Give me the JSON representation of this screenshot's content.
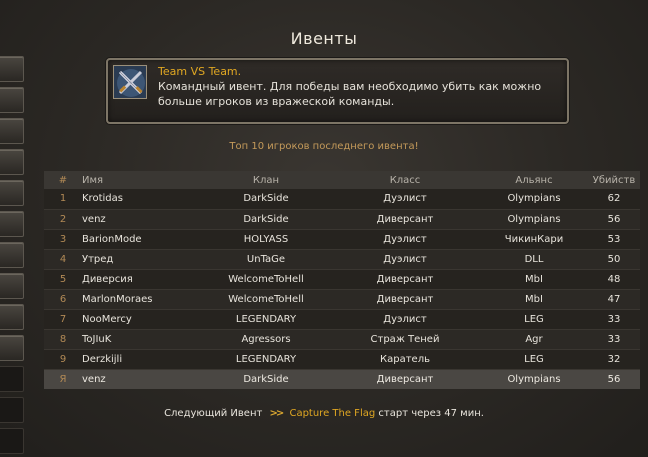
{
  "window": {
    "title": "Ивенты"
  },
  "event": {
    "name": "Team VS Team.",
    "description": "Командный ивент. Для победы вам необходимо убить как можно больше игроков из вражеской команды.",
    "icon": "crossed-swords-icon"
  },
  "subtitle": "Топ 10 игроков последнего ивента!",
  "table": {
    "columns": [
      "#",
      "Имя",
      "Клан",
      "Класс",
      "Альянс",
      "Убийств"
    ],
    "rows": [
      {
        "rank": "1",
        "name": "Krotidas",
        "clan": "DarkSide",
        "class": "Дуэлист",
        "ally": "Olympians",
        "kills": "62"
      },
      {
        "rank": "2",
        "name": "venz",
        "clan": "DarkSide",
        "class": "Диверсант",
        "ally": "Olympians",
        "kills": "56"
      },
      {
        "rank": "3",
        "name": "BarionMode",
        "clan": "HOLYASS",
        "class": "Дуэлист",
        "ally": "ЧикинКари",
        "kills": "53"
      },
      {
        "rank": "4",
        "name": "Утред",
        "clan": "UnTaGe",
        "class": "Дуэлист",
        "ally": "DLL",
        "kills": "50"
      },
      {
        "rank": "5",
        "name": "Диверсия",
        "clan": "WelcomeToHell",
        "class": "Диверсант",
        "ally": "MbI",
        "kills": "48"
      },
      {
        "rank": "6",
        "name": "MarlonMoraes",
        "clan": "WelcomeToHell",
        "class": "Диверсант",
        "ally": "MbI",
        "kills": "47"
      },
      {
        "rank": "7",
        "name": "NooMercy",
        "clan": "LEGENDARY",
        "class": "Дуэлист",
        "ally": "LEG",
        "kills": "33"
      },
      {
        "rank": "8",
        "name": "ToJIuK",
        "clan": "Agressors",
        "class": "Страж Теней",
        "ally": "Agr",
        "kills": "33"
      },
      {
        "rank": "9",
        "name": "Derzkijli",
        "clan": "LEGENDARY",
        "class": "Каратель",
        "ally": "LEG",
        "kills": "32"
      }
    ],
    "me": {
      "rank": "Я",
      "name": "venz",
      "clan": "DarkSide",
      "class": "Диверсант",
      "ally": "Olympians",
      "kills": "56"
    }
  },
  "next_event": {
    "prefix": "Следующий Ивент",
    "arrows": ">>",
    "event": "Capture The Flag",
    "suffix": "старт через 47 мин."
  },
  "colors": {
    "accent": "#e0a722",
    "rank": "#b28a56"
  }
}
